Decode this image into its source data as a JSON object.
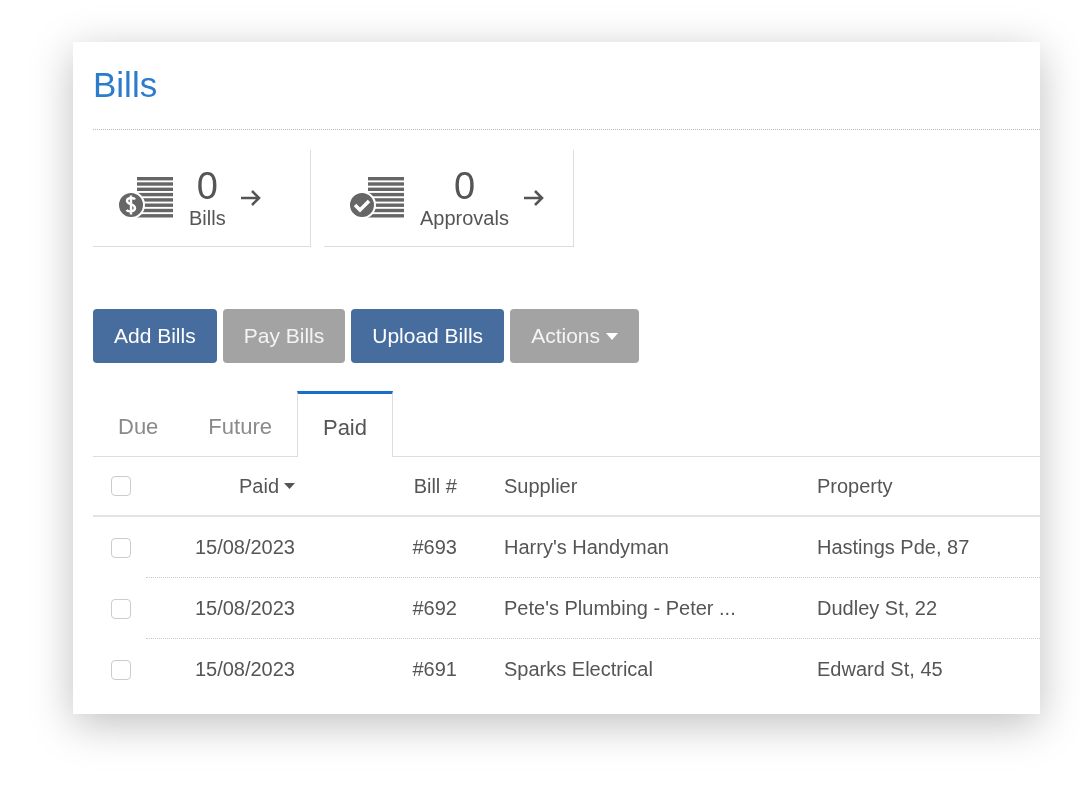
{
  "title": "Bills",
  "summary": [
    {
      "kind": "bills",
      "count": "0",
      "label": "Bills"
    },
    {
      "kind": "approvals",
      "count": "0",
      "label": "Approvals"
    }
  ],
  "buttons": [
    {
      "label": "Add Bills",
      "kind": "primary",
      "dropdown": false
    },
    {
      "label": "Pay Bills",
      "kind": "disabled",
      "dropdown": false
    },
    {
      "label": "Upload Bills",
      "kind": "primary",
      "dropdown": false
    },
    {
      "label": "Actions",
      "kind": "disabled",
      "dropdown": true
    }
  ],
  "tabs": [
    {
      "label": "Due",
      "selected": false
    },
    {
      "label": "Future",
      "selected": false
    },
    {
      "label": "Paid",
      "selected": true
    }
  ],
  "table": {
    "select_all_checked": false,
    "columns": [
      {
        "label": "Paid",
        "sorted": true
      },
      {
        "label": "Bill #",
        "sorted": false
      },
      {
        "label": "Supplier",
        "sorted": false
      },
      {
        "label": "Property",
        "sorted": false
      }
    ],
    "rows": [
      {
        "checked": false,
        "cells": [
          "15/08/2023",
          "#693",
          "Harry's Handyman",
          "Hastings Pde, 87"
        ]
      },
      {
        "checked": false,
        "cells": [
          "15/08/2023",
          "#692",
          "Pete's Plumbing - Peter ...",
          "Dudley St, 22"
        ]
      },
      {
        "checked": false,
        "cells": [
          "15/08/2023",
          "#691",
          "Sparks Electrical",
          "Edward St, 45"
        ]
      }
    ]
  }
}
